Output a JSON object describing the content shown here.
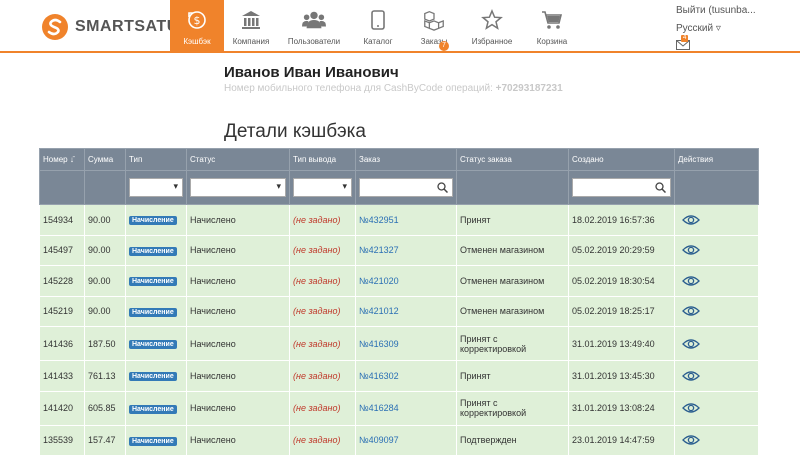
{
  "brand": {
    "name": "SMARTSATU",
    "accent": "#f0832b"
  },
  "nav": [
    {
      "id": "cashback",
      "label": "Кэшбэк",
      "icon": "cashback-icon",
      "active": true
    },
    {
      "id": "company",
      "label": "Компания",
      "icon": "bank-icon"
    },
    {
      "id": "users",
      "label": "Пользователи",
      "icon": "users-icon"
    },
    {
      "id": "catalog",
      "label": "Каталог",
      "icon": "tablet-icon"
    },
    {
      "id": "orders",
      "label": "Заказы",
      "icon": "boxes-icon",
      "badge": "7"
    },
    {
      "id": "favorites",
      "label": "Избранное",
      "icon": "star-icon"
    },
    {
      "id": "cart",
      "label": "Корзина",
      "icon": "cart-icon"
    }
  ],
  "user": {
    "logout": "Выйти (tusunba...",
    "language": "Русский ▿",
    "mail_count": "4"
  },
  "profile": {
    "name": "Иванов Иван Иванович",
    "phone_label": "Номер мобильного телефона для CashByCode операций:",
    "phone": "+70293187231"
  },
  "section_title": "Детали кэшбэка",
  "table": {
    "headers": [
      "Номер",
      "Сумма",
      "Тип",
      "Статус",
      "Тип вывода",
      "Заказ",
      "Статус заказа",
      "Создано",
      "Действия"
    ],
    "sort_icon": "sort-desc-icon",
    "rows": [
      {
        "id": "154934",
        "amount": "90.00",
        "type": "Начисление",
        "status": "Начислено",
        "payout": "(не задано)",
        "order": "№432951",
        "order_status": "Принят",
        "created": "18.02.2019 16:57:36"
      },
      {
        "id": "145497",
        "amount": "90.00",
        "type": "Начисление",
        "status": "Начислено",
        "payout": "(не задано)",
        "order": "№421327",
        "order_status": "Отменен магазином",
        "created": "05.02.2019 20:29:59"
      },
      {
        "id": "145228",
        "amount": "90.00",
        "type": "Начисление",
        "status": "Начислено",
        "payout": "(не задано)",
        "order": "№421020",
        "order_status": "Отменен магазином",
        "created": "05.02.2019 18:30:54"
      },
      {
        "id": "145219",
        "amount": "90.00",
        "type": "Начисление",
        "status": "Начислено",
        "payout": "(не задано)",
        "order": "№421012",
        "order_status": "Отменен магазином",
        "created": "05.02.2019 18:25:17"
      },
      {
        "id": "141436",
        "amount": "187.50",
        "type": "Начисление",
        "status": "Начислено",
        "payout": "(не задано)",
        "order": "№416309",
        "order_status": "Принят с корректировкой",
        "created": "31.01.2019 13:49:40"
      },
      {
        "id": "141433",
        "amount": "761.13",
        "type": "Начисление",
        "status": "Начислено",
        "payout": "(не задано)",
        "order": "№416302",
        "order_status": "Принят",
        "created": "31.01.2019 13:45:30"
      },
      {
        "id": "141420",
        "amount": "605.85",
        "type": "Начисление",
        "status": "Начислено",
        "payout": "(не задано)",
        "order": "№416284",
        "order_status": "Принят с корректировкой",
        "created": "31.01.2019 13:08:24"
      },
      {
        "id": "135539",
        "amount": "157.47",
        "type": "Начисление",
        "status": "Начислено",
        "payout": "(не задано)",
        "order": "№409097",
        "order_status": "Подтвержден",
        "created": "23.01.2019 14:47:59"
      }
    ]
  }
}
